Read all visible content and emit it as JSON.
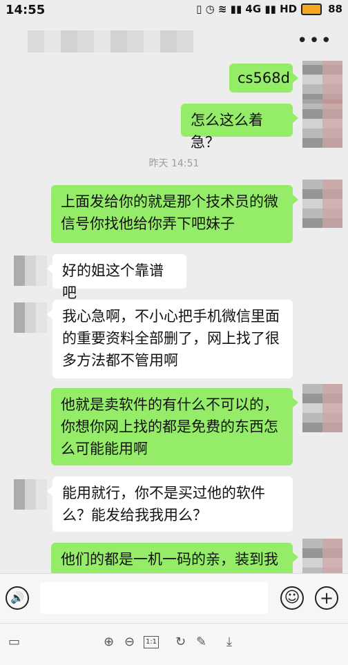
{
  "status": {
    "time": "14:55",
    "icons": "▯ ◷ ≋ ▮▮ 4G ▮▮ HD",
    "battery": "88"
  },
  "nav": {
    "more_icon": "•••"
  },
  "chat": {
    "msg1": "cs568d",
    "msg2": "怎么这么着急？",
    "divider": "昨天 14:51",
    "msg3": "上面发给你的就是那个技术员的微信号你找他给你弄下吧妹子",
    "msg4": "好的姐这个靠谱吧",
    "msg5": "我心急啊，不小心把手机微信里面的重要资料全部删了，网上找了很多方法都不管用啊",
    "msg6": "他就是卖软件的有什么不可以的，你想你网上找的都是免费的东西怎么可能能用啊",
    "msg7": "能用就行，你不是买过他的软件么？能发给我我用么？",
    "msg8": "他们的都是一机一码的亲，装到我"
  },
  "input": {
    "voice_icon": "🔊",
    "emoji_icon": "☺",
    "plus_icon": "+"
  },
  "toolbar": {
    "zoom_in": "⊕",
    "zoom_out": "⊖",
    "page_box": "1:1",
    "rotate": "↻",
    "edit": "✎",
    "download": "⤓"
  }
}
